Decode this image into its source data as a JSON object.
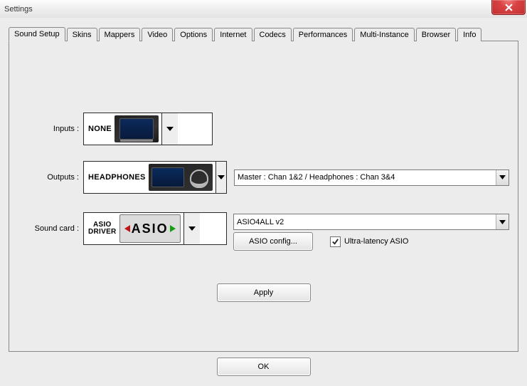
{
  "window": {
    "title": "Settings"
  },
  "tabs": [
    {
      "label": "Sound Setup"
    },
    {
      "label": "Skins"
    },
    {
      "label": "Mappers"
    },
    {
      "label": "Video"
    },
    {
      "label": "Options"
    },
    {
      "label": "Internet"
    },
    {
      "label": "Codecs"
    },
    {
      "label": "Performances"
    },
    {
      "label": "Multi-Instance"
    },
    {
      "label": "Browser"
    },
    {
      "label": "Info"
    }
  ],
  "labels": {
    "inputs": "Inputs :",
    "outputs": "Outputs :",
    "soundcard": "Sound card :"
  },
  "inputs": {
    "selection": "NONE"
  },
  "outputs": {
    "selection": "HEADPHONES",
    "channels": "Master : Chan 1&2 / Headphones : Chan 3&4"
  },
  "soundcard": {
    "selection_line1": "ASIO",
    "selection_line2": "DRIVER",
    "logo_text": "ASIO",
    "driver": "ASIO4ALL v2",
    "config_button": "ASIO config...",
    "ultra_latency_label": "Ultra-latency ASIO",
    "ultra_latency_checked": true
  },
  "buttons": {
    "apply": "Apply",
    "ok": "OK"
  }
}
